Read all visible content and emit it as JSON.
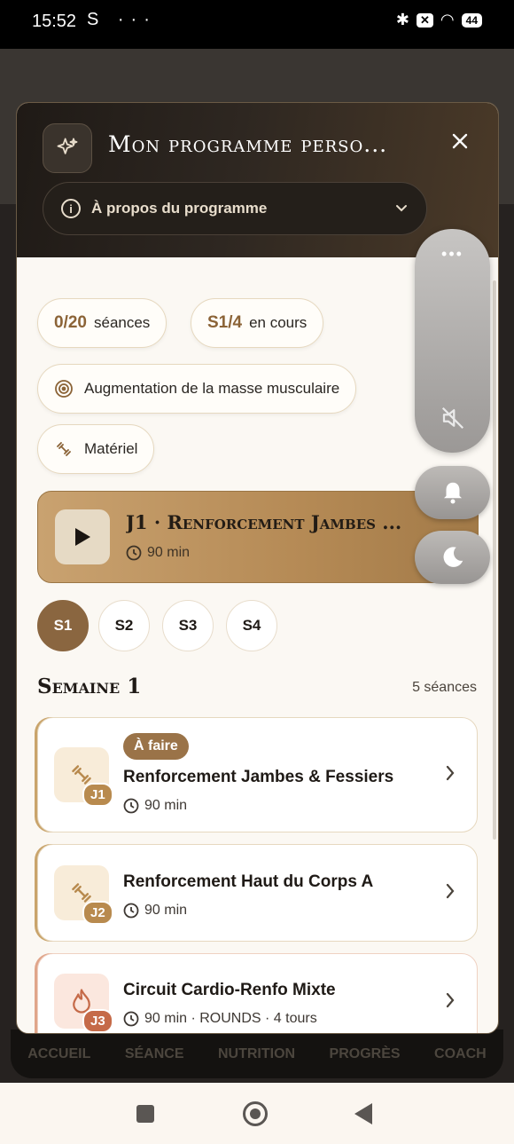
{
  "status_bar": {
    "time": "15:52",
    "left_icons": "S ···",
    "battery": "44"
  },
  "background_nav": [
    "ACCUEIL",
    "SÉANCE",
    "NUTRITION",
    "PROGRÈS",
    "COACH"
  ],
  "modal": {
    "title": "Mon programme perso...",
    "about_label": "À propos du programme",
    "chips": {
      "sessions_value": "0/20",
      "sessions_label": "séances",
      "week_value": "S1/4",
      "week_label": "en cours",
      "goal": "Augmentation de la masse musculaire",
      "equipment": "Matériel"
    },
    "current_session": {
      "title": "J1 · Renforcement Jambes ...",
      "duration": "90 min"
    },
    "weeks": [
      "S1",
      "S2",
      "S3",
      "S4"
    ],
    "week_section": {
      "title": "Semaine 1",
      "count": "5 séances"
    },
    "days": [
      {
        "badge": "J1",
        "status": "À faire",
        "title": "Renforcement Jambes & Fessiers",
        "meta": "90 min"
      },
      {
        "badge": "J2",
        "title": "Renforcement Haut du Corps A",
        "meta": "90 min"
      },
      {
        "badge": "J3",
        "title": "Circuit Cardio-Renfo Mixte",
        "meta": "90 min  · ROUNDS · 4 tours"
      }
    ]
  },
  "colors": {
    "accent": "#8a6640",
    "gold": "#c9a270",
    "dark": "#1f1a16",
    "cardio": "#c56a48"
  },
  "icons": [
    "sparkle-icon",
    "close-icon",
    "info-icon",
    "chevron-down-icon",
    "target-icon",
    "dumbbell-icon",
    "play-icon",
    "clock-icon",
    "chevron-right-icon",
    "flame-icon",
    "mute-icon",
    "bell-icon",
    "moon-icon"
  ]
}
